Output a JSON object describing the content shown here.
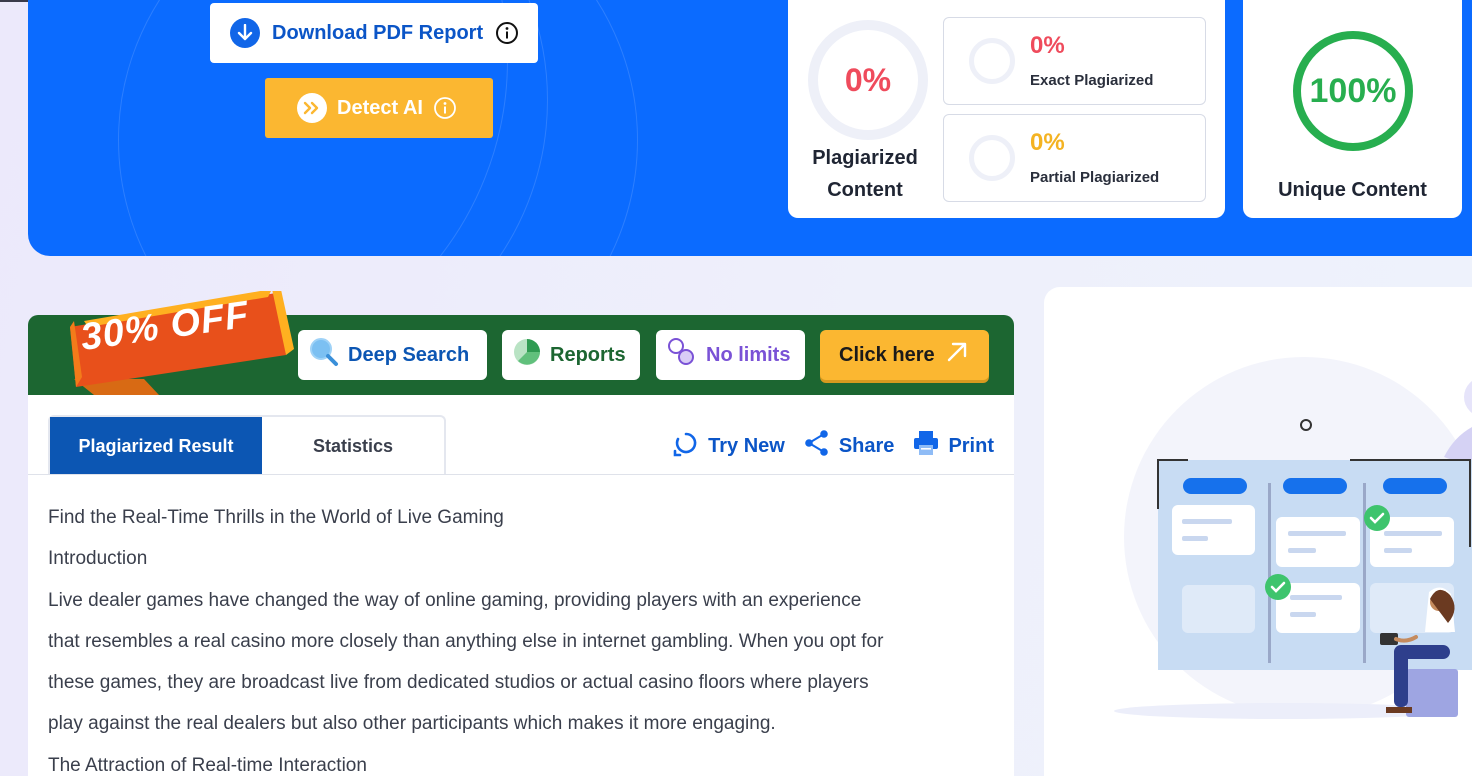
{
  "hero": {
    "download_label": "Download PDF Report",
    "detect_label": "Detect AI",
    "plagiarized": {
      "percent": "0%",
      "label_line1": "Plagiarized",
      "label_line2": "Content"
    },
    "exact": {
      "percent": "0%",
      "label": "Exact Plagiarized"
    },
    "partial": {
      "percent": "0%",
      "label": "Partial Plagiarized"
    },
    "unique": {
      "percent": "100%",
      "label": "Unique Content"
    }
  },
  "promo": {
    "discount": "30% OFF",
    "features": [
      "Deep Search",
      "Reports",
      "No limits"
    ],
    "cta": "Click here"
  },
  "tabs": [
    "Plagiarized Result",
    "Statistics"
  ],
  "actions": [
    "Try New",
    "Share",
    "Print"
  ],
  "content": {
    "line1": "Find the Real-Time Thrills in the World of Live Gaming",
    "line2": "Introduction",
    "para_lines": [
      "Live dealer games have changed the way of online gaming, providing players with an experience",
      "that resembles a real casino more closely than anything else in internet gambling. When you opt for",
      "these games, they are broadcast live from dedicated studios or actual casino floors where players",
      "play against the real dealers but also other participants which makes it more engaging."
    ],
    "line_last": "The Attraction of Real-time Interaction"
  },
  "colors": {
    "hero_blue": "#0b6bff",
    "plag_red": "#ef4b5c",
    "partial_orange": "#f4b322",
    "unique_green": "#27ae4f",
    "promo_green": "#1c6631",
    "cta_yellow": "#fbb731"
  }
}
